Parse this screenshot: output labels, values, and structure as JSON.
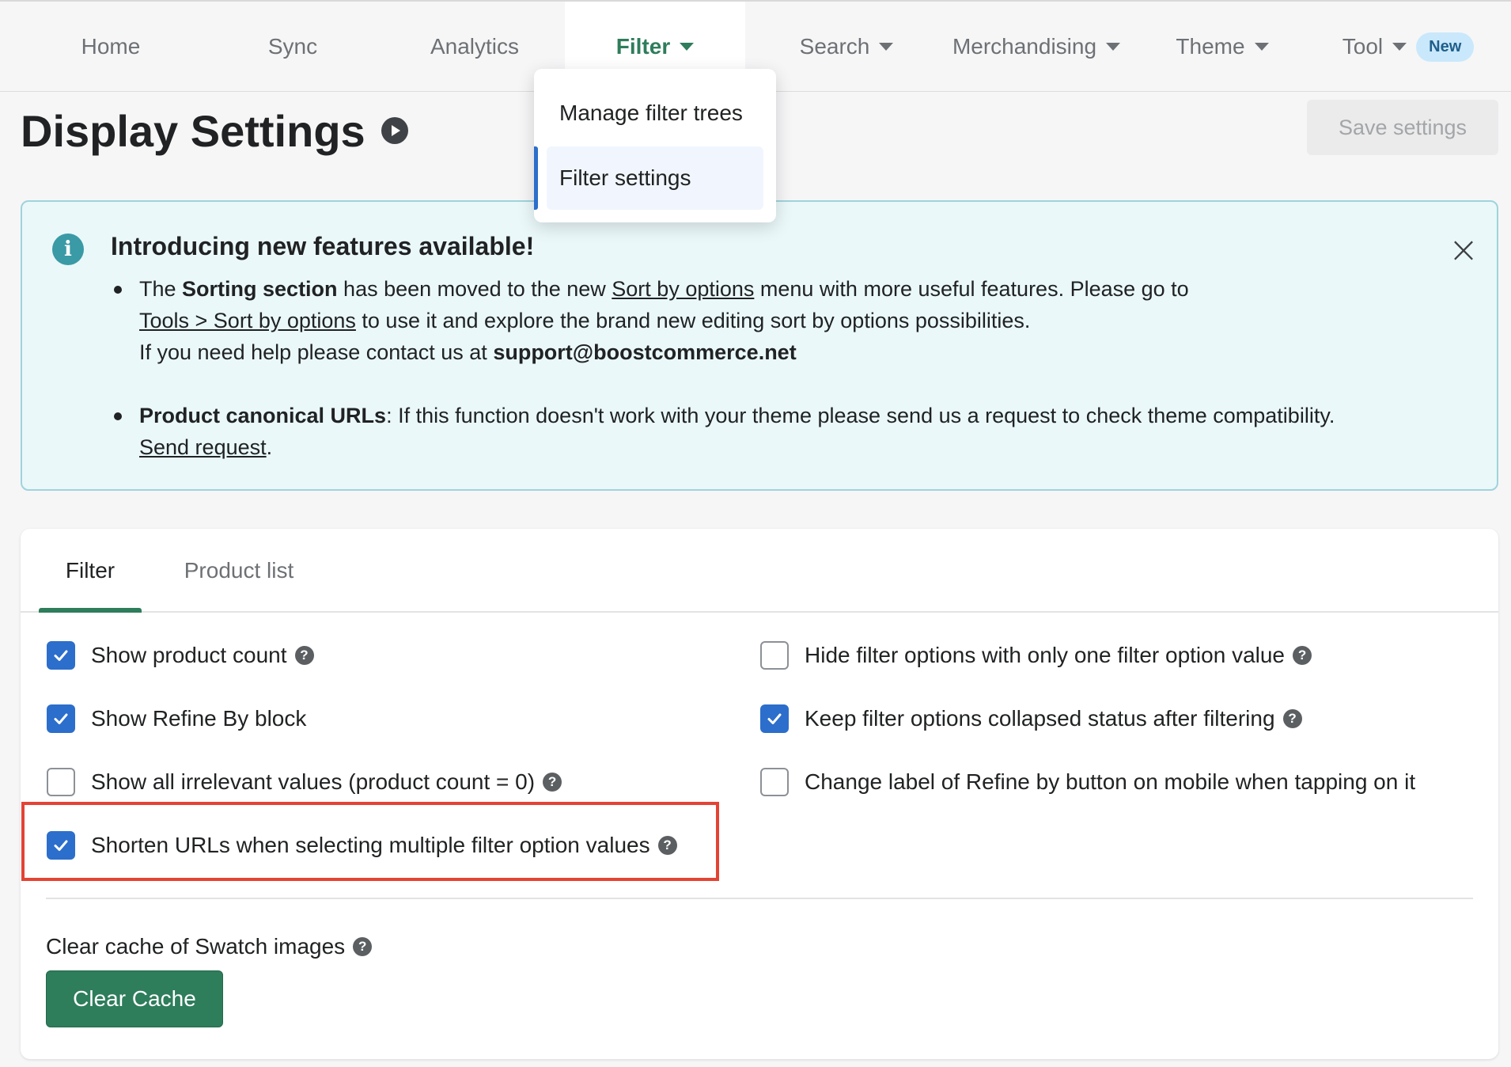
{
  "nav": {
    "items": [
      {
        "label": "Home"
      },
      {
        "label": "Sync"
      },
      {
        "label": "Analytics"
      },
      {
        "label": "Filter"
      },
      {
        "label": "Search"
      },
      {
        "label": "Merchandising"
      },
      {
        "label": "Theme"
      },
      {
        "label": "Tool"
      }
    ],
    "active": "Filter",
    "tool_badge": "New"
  },
  "dropdown": {
    "items": [
      {
        "label": "Manage filter trees"
      },
      {
        "label": "Filter settings"
      }
    ],
    "selected": "Filter settings"
  },
  "page": {
    "title": "Display Settings",
    "save_label": "Save settings"
  },
  "banner": {
    "title": "Introducing new features available!",
    "item1": {
      "p1": "The ",
      "bold1": "Sorting section",
      "p2": " has been moved to the new ",
      "link1": "Sort by options",
      "p3": " menu with more useful features. Please go to",
      "link2": "Tools > Sort by options",
      "p4": " to use it and explore the brand new editing sort by options possibilities.",
      "p5": "If you need help please contact us at ",
      "email": "support@boostcommerce.net"
    },
    "item2": {
      "bold": "Product canonical URLs",
      "text": ": If this function doesn't work with your theme please send us a request to check theme compatibility.",
      "link": "Send request",
      "end": "."
    }
  },
  "tabs": [
    {
      "label": "Filter"
    },
    {
      "label": "Product list"
    }
  ],
  "options": {
    "left": [
      {
        "label": "Show product count",
        "checked": true,
        "help": true
      },
      {
        "label": "Show Refine By block",
        "checked": true,
        "help": false
      },
      {
        "label": "Show all irrelevant values (product count = 0)",
        "checked": false,
        "help": true
      },
      {
        "label": "Shorten URLs when selecting multiple filter option values",
        "checked": true,
        "help": true
      }
    ],
    "right": [
      {
        "label": "Hide filter options with only one filter option value",
        "checked": false,
        "help": true
      },
      {
        "label": "Keep filter options collapsed status after filtering",
        "checked": true,
        "help": true
      },
      {
        "label": "Change label of Refine by button on mobile when tapping on it",
        "checked": false,
        "help": false
      }
    ]
  },
  "cache": {
    "label": "Clear cache of Swatch images",
    "button": "Clear Cache"
  },
  "colors": {
    "accent_green": "#2e7d5b",
    "checkbox_blue": "#2c6ecb",
    "highlight_red": "#e44333",
    "banner_bg": "#eaf8fa"
  }
}
